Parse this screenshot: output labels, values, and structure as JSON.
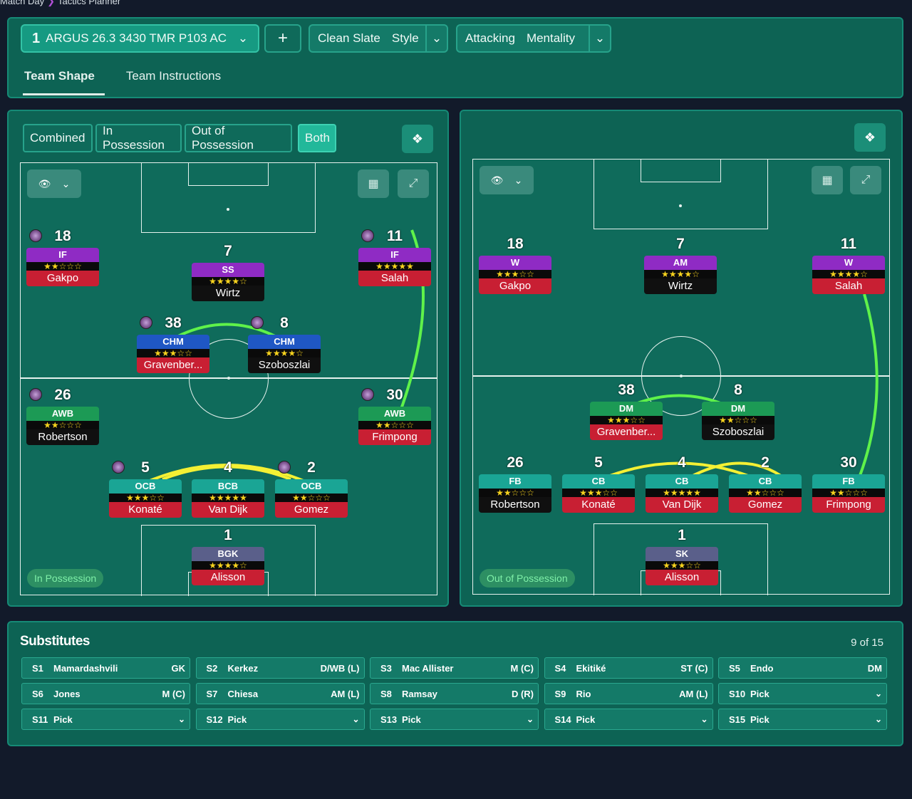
{
  "breadcrumb": {
    "part1": "Match Day",
    "part2": "Tactics Planner"
  },
  "toolbar": {
    "tactic_number": "1",
    "tactic_name": "ARGUS 26.3 3430 TMR P103 AC",
    "add_label": "+",
    "style_value": "Clean Slate",
    "style_label": "Style",
    "mentality_value": "Attacking",
    "mentality_label": "Mentality"
  },
  "tabs": [
    "Team Shape",
    "Team Instructions"
  ],
  "segments": [
    "Combined",
    "In Possession",
    "Out of Possession",
    "Both"
  ],
  "left_pitch": {
    "phase": "In Possession",
    "players": [
      {
        "num": "18",
        "role": "IF",
        "stars": "★★☆☆☆",
        "name": "Gakpo",
        "kit": "dark"
      },
      {
        "num": "7",
        "role": "SS",
        "stars": "★★★★☆",
        "name": "Wirtz",
        "kit": "red"
      },
      {
        "num": "11",
        "role": "IF",
        "stars": "★★★★★",
        "name": "Salah",
        "kit": "dark"
      },
      {
        "num": "38",
        "role": "CHM",
        "stars": "★★★☆☆",
        "name": "Gravenber...",
        "kit": "dark"
      },
      {
        "num": "8",
        "role": "CHM",
        "stars": "★★★★☆",
        "name": "Szoboszlai",
        "kit": "red"
      },
      {
        "num": "26",
        "role": "AWB",
        "stars": "★★☆☆☆",
        "name": "Robertson",
        "kit": "red"
      },
      {
        "num": "30",
        "role": "AWB",
        "stars": "★★☆☆☆",
        "name": "Frimpong",
        "kit": "dark"
      },
      {
        "num": "5",
        "role": "OCB",
        "stars": "★★★☆☆",
        "name": "Konaté",
        "kit": "dark"
      },
      {
        "num": "4",
        "role": "BCB",
        "stars": "★★★★★",
        "name": "Van Dijk",
        "kit": "dark"
      },
      {
        "num": "2",
        "role": "OCB",
        "stars": "★★☆☆☆",
        "name": "Gomez",
        "kit": "dark"
      },
      {
        "num": "1",
        "role": "BGK",
        "stars": "★★★★☆",
        "name": "Alisson",
        "kit": "dark"
      }
    ]
  },
  "right_pitch": {
    "phase": "Out of Possession",
    "players": [
      {
        "num": "18",
        "role": "W",
        "stars": "★★★☆☆",
        "name": "Gakpo",
        "kit": "dark"
      },
      {
        "num": "7",
        "role": "AM",
        "stars": "★★★★☆",
        "name": "Wirtz",
        "kit": "red"
      },
      {
        "num": "11",
        "role": "W",
        "stars": "★★★★☆",
        "name": "Salah",
        "kit": "dark"
      },
      {
        "num": "38",
        "role": "DM",
        "stars": "★★★☆☆",
        "name": "Gravenber...",
        "kit": "dark"
      },
      {
        "num": "8",
        "role": "DM",
        "stars": "★★☆☆☆",
        "name": "Szoboszlai",
        "kit": "red"
      },
      {
        "num": "26",
        "role": "FB",
        "stars": "★★☆☆☆",
        "name": "Robertson",
        "kit": "red"
      },
      {
        "num": "5",
        "role": "CB",
        "stars": "★★★☆☆",
        "name": "Konaté",
        "kit": "dark"
      },
      {
        "num": "4",
        "role": "CB",
        "stars": "★★★★★",
        "name": "Van Dijk",
        "kit": "dark"
      },
      {
        "num": "2",
        "role": "CB",
        "stars": "★★☆☆☆",
        "name": "Gomez",
        "kit": "dark"
      },
      {
        "num": "30",
        "role": "FB",
        "stars": "★★☆☆☆",
        "name": "Frimpong",
        "kit": "dark"
      },
      {
        "num": "1",
        "role": "SK",
        "stars": "★★★☆☆",
        "name": "Alisson",
        "kit": "dark"
      }
    ]
  },
  "substitutes": {
    "title": "Substitutes",
    "count": "9 of 15",
    "slots": [
      {
        "slot": "S1",
        "name": "Mamardashvili",
        "pos": "GK"
      },
      {
        "slot": "S2",
        "name": "Kerkez",
        "pos": "D/WB (L)"
      },
      {
        "slot": "S3",
        "name": "Mac Allister",
        "pos": "M (C)"
      },
      {
        "slot": "S4",
        "name": "Ekitiké",
        "pos": "ST (C)"
      },
      {
        "slot": "S5",
        "name": "Endo",
        "pos": "DM"
      },
      {
        "slot": "S6",
        "name": "Jones",
        "pos": "M (C)"
      },
      {
        "slot": "S7",
        "name": "Chiesa",
        "pos": "AM (L)"
      },
      {
        "slot": "S8",
        "name": "Ramsay",
        "pos": "D (R)"
      },
      {
        "slot": "S9",
        "name": "Rio",
        "pos": "AM (L)"
      },
      {
        "slot": "S10",
        "name": "Pick",
        "pos": "⌄"
      },
      {
        "slot": "S11",
        "name": "Pick",
        "pos": "⌄"
      },
      {
        "slot": "S12",
        "name": "Pick",
        "pos": "⌄"
      },
      {
        "slot": "S13",
        "name": "Pick",
        "pos": "⌄"
      },
      {
        "slot": "S14",
        "name": "Pick",
        "pos": "⌄"
      },
      {
        "slot": "S15",
        "name": "Pick",
        "pos": "⌄"
      }
    ]
  }
}
